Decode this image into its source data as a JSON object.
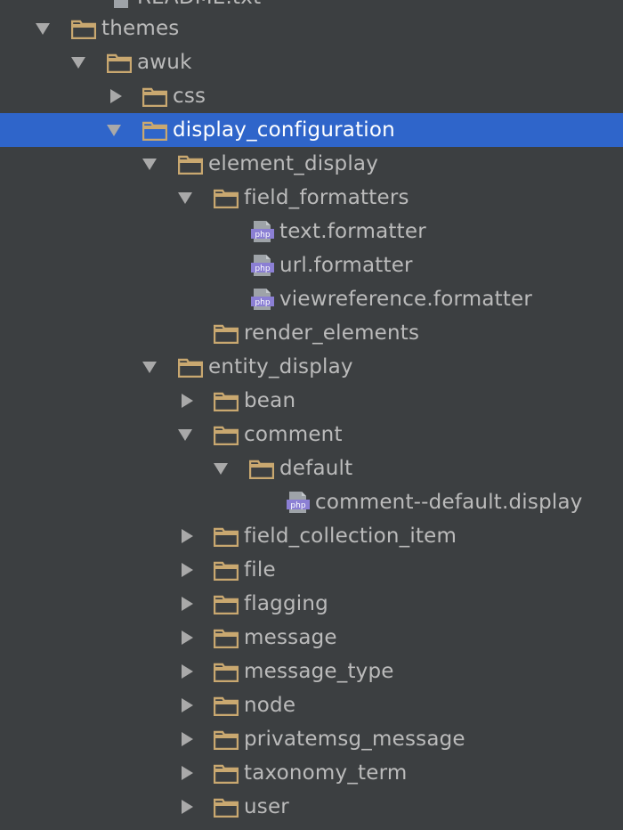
{
  "tree": {
    "top_partial_label": "README.txt",
    "items": [
      {
        "label": "themes",
        "type": "folder",
        "state": "expanded"
      },
      {
        "label": "awuk",
        "type": "folder",
        "state": "expanded"
      },
      {
        "label": "css",
        "type": "folder",
        "state": "collapsed"
      },
      {
        "label": "display_configuration",
        "type": "folder",
        "state": "expanded",
        "selected": true
      },
      {
        "label": "element_display",
        "type": "folder",
        "state": "expanded"
      },
      {
        "label": "field_formatters",
        "type": "folder",
        "state": "expanded"
      },
      {
        "label": "text.formatter",
        "type": "php-file"
      },
      {
        "label": "url.formatter",
        "type": "php-file"
      },
      {
        "label": "viewreference.formatter",
        "type": "php-file"
      },
      {
        "label": "render_elements",
        "type": "folder",
        "state": "leaf"
      },
      {
        "label": "entity_display",
        "type": "folder",
        "state": "expanded"
      },
      {
        "label": "bean",
        "type": "folder",
        "state": "collapsed"
      },
      {
        "label": "comment",
        "type": "folder",
        "state": "expanded"
      },
      {
        "label": "default",
        "type": "folder",
        "state": "expanded"
      },
      {
        "label": "comment--default.display",
        "type": "php-file"
      },
      {
        "label": "field_collection_item",
        "type": "folder",
        "state": "collapsed"
      },
      {
        "label": "file",
        "type": "folder",
        "state": "collapsed"
      },
      {
        "label": "flagging",
        "type": "folder",
        "state": "collapsed"
      },
      {
        "label": "message",
        "type": "folder",
        "state": "collapsed"
      },
      {
        "label": "message_type",
        "type": "folder",
        "state": "collapsed"
      },
      {
        "label": "node",
        "type": "folder",
        "state": "collapsed"
      },
      {
        "label": "privatemsg_message",
        "type": "folder",
        "state": "collapsed"
      },
      {
        "label": "taxonomy_term",
        "type": "folder",
        "state": "collapsed"
      },
      {
        "label": "user",
        "type": "folder",
        "state": "collapsed"
      }
    ],
    "php_badge": "php"
  },
  "colors": {
    "background": "#3c3f41",
    "selection": "#2f65ca",
    "text": "#bbbbbb",
    "folder": "#c9a870",
    "php_badge": "#8b7fd4"
  }
}
